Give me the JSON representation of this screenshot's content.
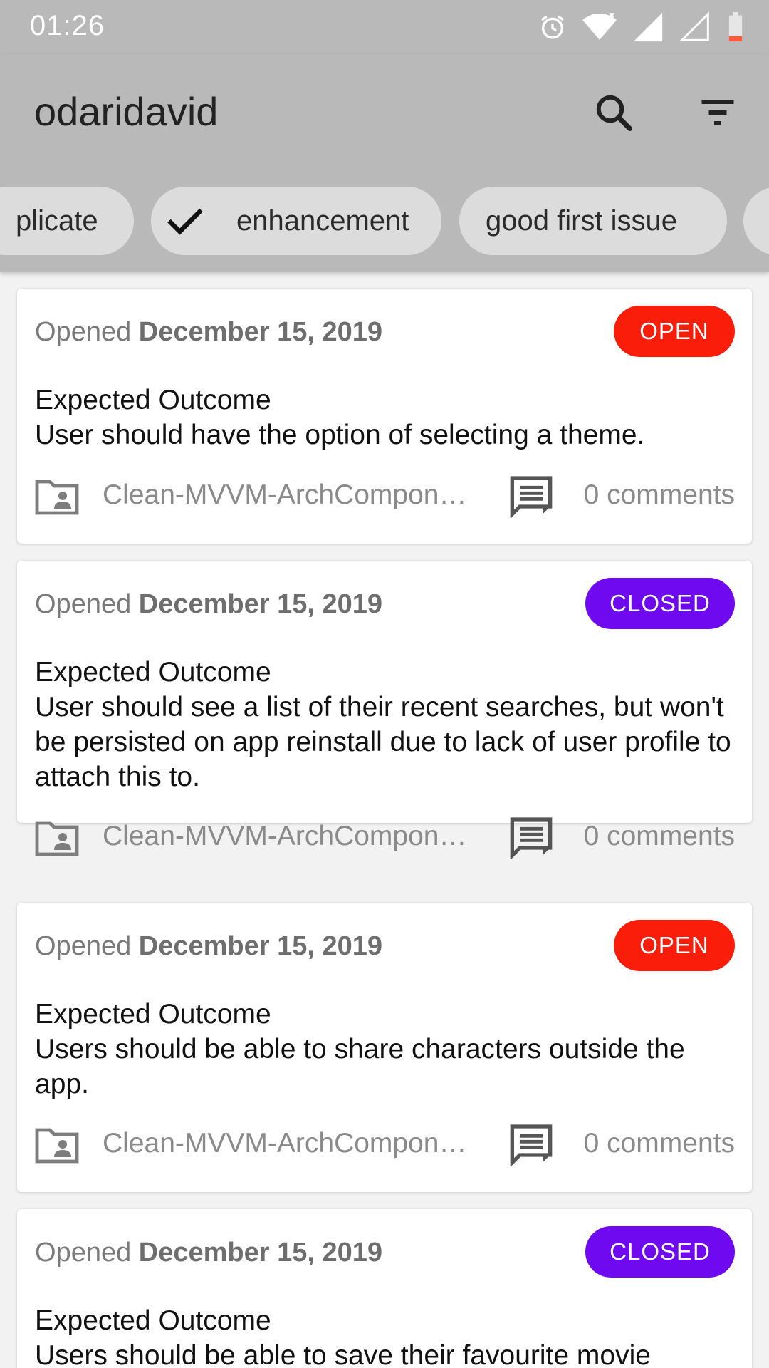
{
  "status_bar": {
    "time": "01:26"
  },
  "app_bar": {
    "title": "odaridavid"
  },
  "chips": [
    {
      "label": "plicate",
      "selected": false
    },
    {
      "label": "enhancement",
      "selected": true
    },
    {
      "label": "good first issue",
      "selected": false
    },
    {
      "label": "",
      "selected": false
    }
  ],
  "issues": [
    {
      "opened_label": "Opened",
      "date": "December 15, 2019",
      "status": "OPEN",
      "body": "Expected Outcome\nUser should have the option of selecting a theme.",
      "repo": "Clean-MVVM-ArchComponents",
      "comments": "0 comments"
    },
    {
      "opened_label": "Opened",
      "date": "December 15, 2019",
      "status": "CLOSED",
      "body": "Expected Outcome\nUser should see a list of their recent searches, but won't be persisted on app reinstall due to lack of user profile to attach this to.",
      "repo": "Clean-MVVM-ArchComponents",
      "comments": "0 comments"
    },
    {
      "opened_label": "Opened",
      "date": "December 15, 2019",
      "status": "OPEN",
      "body": "Expected Outcome\nUsers should be able to share characters outside the app.",
      "repo": "Clean-MVVM-ArchComponents",
      "comments": "0 comments"
    },
    {
      "opened_label": "Opened",
      "date": "December 15, 2019",
      "status": "CLOSED",
      "body": "Expected Outcome\nUsers should be able to save their favourite movie",
      "repo": "",
      "comments": ""
    }
  ],
  "colors": {
    "app_bar": "#b9b9b9",
    "open": "#fa1e0a",
    "closed": "#6f09f0"
  }
}
